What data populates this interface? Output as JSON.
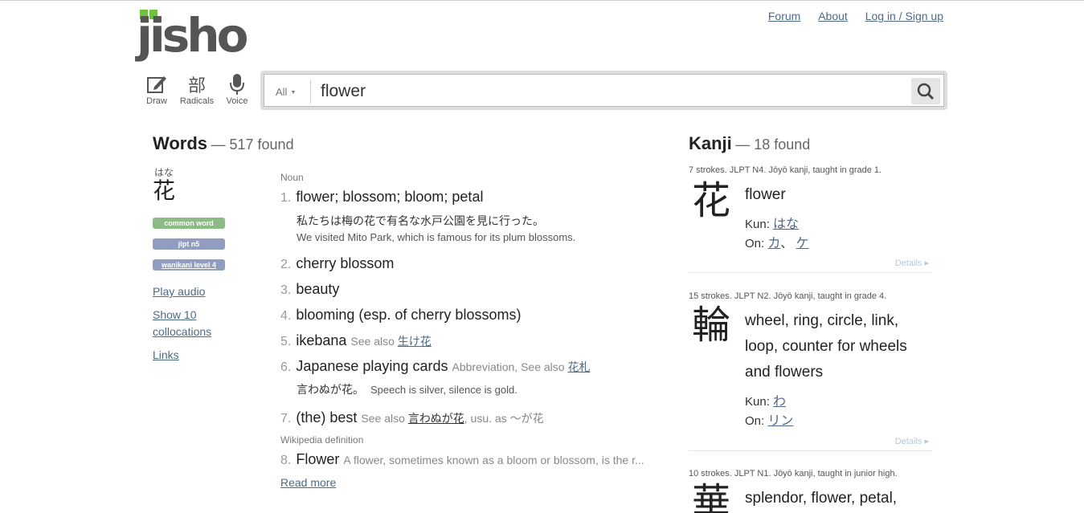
{
  "nav": {
    "forum": "Forum",
    "about": "About",
    "login": "Log in / Sign up"
  },
  "logo": {
    "text": "jisho"
  },
  "input_methods": [
    {
      "label": "Draw",
      "icon": "pencil-icon",
      "glyph": "✎"
    },
    {
      "label": "Radicals",
      "icon": "radicals-icon",
      "glyph": "部"
    },
    {
      "label": "Voice",
      "icon": "microphone-icon",
      "glyph": "🎤"
    }
  ],
  "search": {
    "scope": "All",
    "value": "flower"
  },
  "words": {
    "heading": "Words",
    "count": "— 517 found",
    "entry": {
      "furigana": "はな",
      "word": "花",
      "tags": [
        "common word",
        "jlpt n5",
        "wanikani level 4"
      ],
      "links": [
        "Play audio",
        "Show 10 collocations",
        "Links"
      ],
      "pos": "Noun",
      "meanings": [
        {
          "num": "1.",
          "text": "flower; blossom; bloom; petal",
          "extra": ""
        },
        {
          "num": "2.",
          "text": "cherry blossom",
          "extra": ""
        },
        {
          "num": "3.",
          "text": "beauty",
          "extra": ""
        },
        {
          "num": "4.",
          "text": "blooming (esp. of cherry blossoms)",
          "extra": ""
        },
        {
          "num": "5.",
          "text": "ikebana",
          "extra": "See also ",
          "link": "生け花"
        },
        {
          "num": "6.",
          "text": "Japanese playing cards",
          "extra": "Abbreviation, See also ",
          "link": "花札"
        },
        {
          "num": "7.",
          "text": "(the) best",
          "extra": "See also ",
          "link": "言わぬが花",
          "extra2": ", usu. as ～が花"
        }
      ],
      "sentence1": {
        "ja": "私たちは梅の花で有名な水戸公園を見に行った。",
        "en": "We visited Mito Park, which is famous for its plum blossoms."
      },
      "sentence2": {
        "ja": "言わぬが花。",
        "en": "Speech is silver, silence is gold."
      },
      "wiki_pos": "Wikipedia definition",
      "wiki": {
        "num": "8.",
        "text": "Flower",
        "extra": "A flower, sometimes known as a bloom or blossom, is the r..."
      },
      "read_more": "Read more"
    }
  },
  "kanji": {
    "heading": "Kanji",
    "count": "— 18 found",
    "items": [
      {
        "info": "7 strokes. JLPT N4. Jōyō kanji, taught in grade 1.",
        "char": "花",
        "meaning": "flower",
        "kun_label": "Kun:",
        "kun": [
          "はな"
        ],
        "on_label": "On:",
        "on": [
          "カ",
          "ケ"
        ],
        "details": "Details ▸"
      },
      {
        "info": "15 strokes. JLPT N2. Jōyō kanji, taught in grade 4.",
        "char": "輪",
        "meaning": "wheel, ring, circle, link, loop, counter for wheels and flowers",
        "kun_label": "Kun:",
        "kun": [
          "わ"
        ],
        "on_label": "On:",
        "on": [
          "リン"
        ],
        "details": "Details ▸"
      },
      {
        "info": "10 strokes. JLPT N1. Jōyō kanji, taught in junior high.",
        "char": "華",
        "meaning": "splendor, flower, petal,"
      }
    ]
  },
  "colors": {
    "link": "#4d6a8a",
    "common_tag": "#8abc83",
    "jlpt_tag": "#909dc0"
  }
}
